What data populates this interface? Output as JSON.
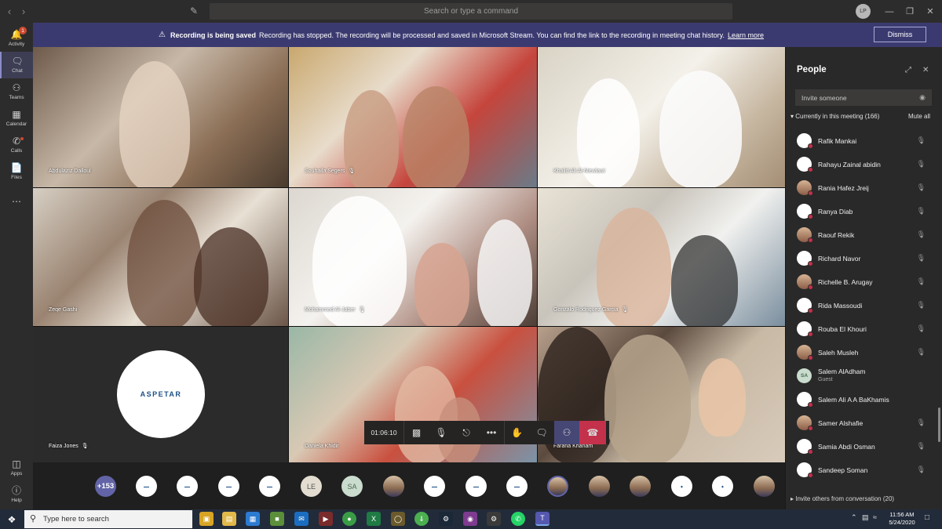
{
  "titlebar": {
    "command_placeholder": "Search or type a command",
    "user_initials": "LP"
  },
  "rail": {
    "items": [
      {
        "label": "Activity",
        "icon": "bell-icon",
        "badge": "1"
      },
      {
        "label": "Chat",
        "icon": "chat-icon"
      },
      {
        "label": "Teams",
        "icon": "teams-icon"
      },
      {
        "label": "Calendar",
        "icon": "calendar-icon"
      },
      {
        "label": "Calls",
        "icon": "phone-icon"
      },
      {
        "label": "Files",
        "icon": "file-icon"
      }
    ],
    "bottom": [
      {
        "label": "Apps",
        "icon": "apps-icon"
      },
      {
        "label": "Help",
        "icon": "help-icon"
      }
    ]
  },
  "banner": {
    "title": "Recording is being saved",
    "message": "Recording has stopped. The recording will be processed and saved in Microsoft Stream. You can find the link to the recording in meeting chat history.",
    "link": "Learn more",
    "dismiss": "Dismiss"
  },
  "tiles": [
    {
      "name": "Abdulaziz Dalloul",
      "muted": false
    },
    {
      "name": "Souhaila Segers",
      "muted": true
    },
    {
      "name": "Khalid Ali Al-Mewlawi",
      "muted": false
    },
    {
      "name": "Zeqe Gashi",
      "muted": false
    },
    {
      "name": "Mohammed Al-Jaber",
      "muted": true
    },
    {
      "name": "Gonzalo Rodriguez Garcia",
      "muted": true
    },
    {
      "name": "Faiza Jones",
      "muted": true,
      "logo": "ASPETAR"
    },
    {
      "name": "Daniela Khidir",
      "muted": false
    },
    {
      "name": "Farana Khanam",
      "muted": false
    }
  ],
  "controls": {
    "timer": "01:06:10"
  },
  "strip": {
    "overflow": "+153",
    "initials": [
      "LE",
      "SA"
    ]
  },
  "panel": {
    "title": "People",
    "invite_placeholder": "Invite someone",
    "section": "Currently in this meeting (166)",
    "mute_all": "Mute all",
    "participants": [
      {
        "name": "Rafik Mankai"
      },
      {
        "name": "Rahayu Zainal abidin"
      },
      {
        "name": "Rania Hafez Jreij"
      },
      {
        "name": "Ranya Diab"
      },
      {
        "name": "Raouf Rekik"
      },
      {
        "name": "Richard Navor"
      },
      {
        "name": "Richelle B. Arugay"
      },
      {
        "name": "Rida Massoudi"
      },
      {
        "name": "Rouba El Khouri"
      },
      {
        "name": "Saleh Musleh"
      },
      {
        "name": "Salem AlAdham",
        "role": "Guest",
        "initials": "SA"
      },
      {
        "name": "Salem Ali A A BaKhamis"
      },
      {
        "name": "Samer Alshafie"
      },
      {
        "name": "Samia Abdi Osman"
      },
      {
        "name": "Sandeep Soman"
      }
    ],
    "invite_others": "Invite others from conversation (20)"
  },
  "taskbar": {
    "search_placeholder": "Type here to search",
    "time": "11:56 AM",
    "date": "5/24/2020"
  }
}
